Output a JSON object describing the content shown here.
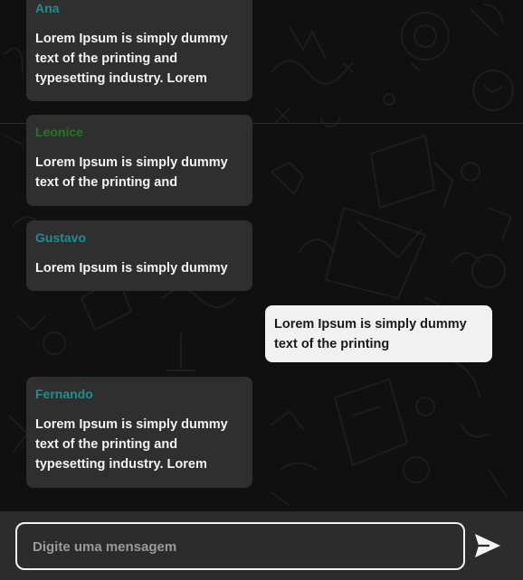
{
  "messages": [
    {
      "sender": "Ana",
      "sender_color": "#1e8f8f",
      "text": "Lorem Ipsum is simply dummy text of the printing and typesetting industry. Lorem",
      "direction": "incoming"
    },
    {
      "sender": "Leonice",
      "sender_color": "#1f7a1f",
      "text": "Lorem Ipsum is simply dummy text of the printing and",
      "direction": "incoming"
    },
    {
      "sender": "Gustavo",
      "sender_color": "#1e8f8f",
      "text": "Lorem Ipsum is simply dummy",
      "direction": "incoming"
    },
    {
      "sender": "",
      "text": "Lorem Ipsum is simply dummy text of the printing",
      "direction": "outgoing"
    },
    {
      "sender": "Fernando",
      "sender_color": "#1e8f8f",
      "text": "Lorem Ipsum is simply dummy text of the printing and typesetting industry. Lorem",
      "direction": "incoming"
    }
  ],
  "composer": {
    "placeholder": "Digite uma mensagem",
    "send_icon": "send-icon"
  },
  "colors": {
    "incoming_bubble": "#2f2f2f",
    "outgoing_bubble": "#f1f1f1",
    "composer_bg": "#2c2c2c"
  }
}
